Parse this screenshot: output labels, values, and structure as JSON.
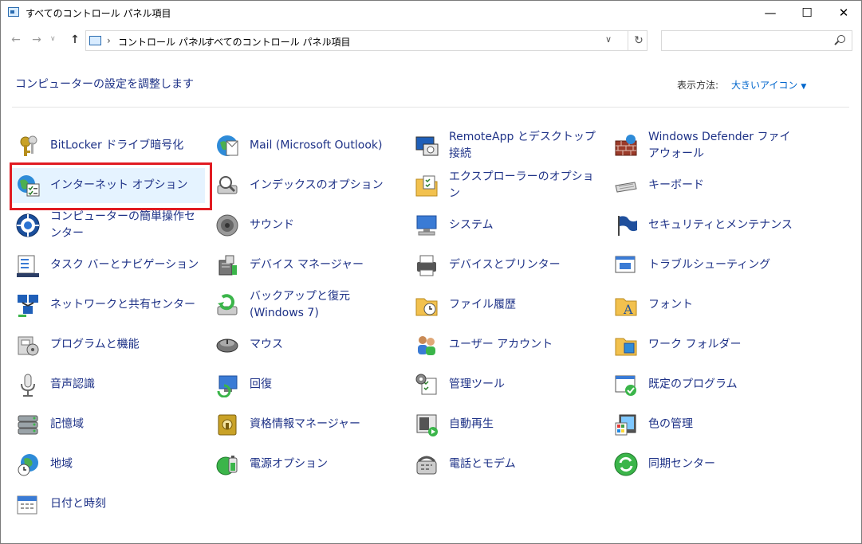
{
  "window": {
    "title": "すべてのコントロール パネル項目",
    "minimize": "—",
    "maximize": "☐",
    "close": "✕"
  },
  "nav": {
    "back": "←",
    "forward": "→",
    "recent": "∨",
    "up": "↑",
    "crumbs": [
      "コントロール パネル",
      "すべてのコントロール パネル項目"
    ],
    "separator": "›",
    "dropdown": "∨",
    "refresh": "↻",
    "search_placeholder": ""
  },
  "header": {
    "title": "コンピューターの設定を調整します",
    "view_by_label": "表示方法:",
    "view_by_value": "大きいアイコン",
    "caret": "▼"
  },
  "highlighted_item": "インターネット オプション",
  "columns": [
    [
      {
        "label": "BitLocker ドライブ暗号化",
        "icon": "bitlocker-keys-icon"
      },
      {
        "label": "インターネット オプション",
        "icon": "internet-options-icon",
        "selected": true
      },
      {
        "label": "コンピューターの簡単操作センター",
        "icon": "ease-of-access-icon"
      },
      {
        "label": "タスク バーとナビゲーション",
        "icon": "taskbar-icon"
      },
      {
        "label": "ネットワークと共有センター",
        "icon": "network-icon"
      },
      {
        "label": "プログラムと機能",
        "icon": "programs-icon"
      },
      {
        "label": "音声認識",
        "icon": "microphone-icon"
      },
      {
        "label": "記憶域",
        "icon": "storage-icon"
      },
      {
        "label": "地域",
        "icon": "region-icon"
      },
      {
        "label": "日付と時刻",
        "icon": "date-time-icon"
      }
    ],
    [
      {
        "label": "Mail (Microsoft Outlook)",
        "icon": "mail-icon"
      },
      {
        "label": "インデックスのオプション",
        "icon": "indexing-icon"
      },
      {
        "label": "サウンド",
        "icon": "speaker-icon"
      },
      {
        "label": "デバイス マネージャー",
        "icon": "device-manager-icon"
      },
      {
        "label": "バックアップと復元 (Windows 7)",
        "icon": "backup-icon"
      },
      {
        "label": "マウス",
        "icon": "mouse-icon"
      },
      {
        "label": "回復",
        "icon": "recovery-icon"
      },
      {
        "label": "資格情報マネージャー",
        "icon": "credential-icon"
      },
      {
        "label": "電源オプション",
        "icon": "power-icon"
      }
    ],
    [
      {
        "label": "RemoteApp とデスクトップ接続",
        "icon": "remoteapp-icon"
      },
      {
        "label": "エクスプローラーのオプション",
        "icon": "folder-options-icon"
      },
      {
        "label": "システム",
        "icon": "system-icon"
      },
      {
        "label": "デバイスとプリンター",
        "icon": "printer-icon"
      },
      {
        "label": "ファイル履歴",
        "icon": "file-history-icon"
      },
      {
        "label": "ユーザー アカウント",
        "icon": "user-accounts-icon"
      },
      {
        "label": "管理ツール",
        "icon": "admin-tools-icon"
      },
      {
        "label": "自動再生",
        "icon": "autoplay-icon"
      },
      {
        "label": "電話とモデム",
        "icon": "phone-modem-icon"
      }
    ],
    [
      {
        "label": "Windows Defender ファイアウォール",
        "icon": "firewall-icon"
      },
      {
        "label": "キーボード",
        "icon": "keyboard-icon"
      },
      {
        "label": "セキュリティとメンテナンス",
        "icon": "security-flag-icon"
      },
      {
        "label": "トラブルシューティング",
        "icon": "troubleshooting-icon"
      },
      {
        "label": "フォント",
        "icon": "fonts-icon"
      },
      {
        "label": "ワーク フォルダー",
        "icon": "work-folders-icon"
      },
      {
        "label": "既定のプログラム",
        "icon": "default-programs-icon"
      },
      {
        "label": "色の管理",
        "icon": "color-management-icon"
      },
      {
        "label": "同期センター",
        "icon": "sync-center-icon"
      }
    ]
  ]
}
